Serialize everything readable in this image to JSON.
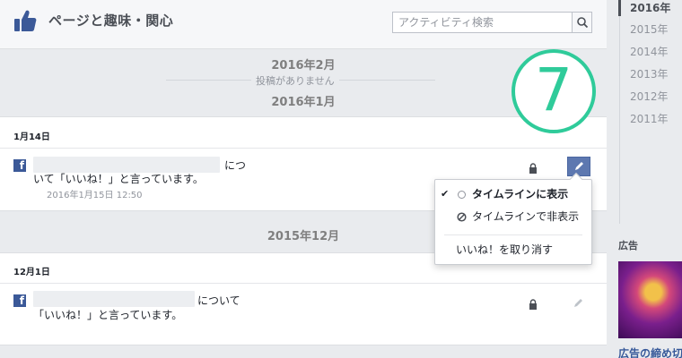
{
  "header": {
    "title": "ページと趣味・関心",
    "search_placeholder": "アクティビティ検索"
  },
  "sections": [
    {
      "month": "2016年2月",
      "no_posts": "投稿がありません"
    },
    {
      "month": "2016年1月"
    },
    {
      "month": "2015年12月"
    }
  ],
  "posts": [
    {
      "date": "1月14日",
      "text_line1": "につ",
      "text_line2": "いて「いいね！」と言っています。",
      "timestamp": "2016年1月15日 12:50"
    },
    {
      "date": "12月1日",
      "text_line1": "について",
      "text_line2": "「いいね！」と言っています。"
    }
  ],
  "dropdown": {
    "items": [
      {
        "label": "タイムラインに表示",
        "checked": true
      },
      {
        "label": "タイムラインで非表示",
        "checked": false
      },
      {
        "label": "いいね！を取り消す"
      }
    ]
  },
  "overlay": {
    "step_number": "7"
  },
  "rail": {
    "years": [
      "2016年",
      "2015年",
      "2014年",
      "2013年",
      "2012年",
      "2011年"
    ],
    "active_year": "2016年",
    "ad_label": "広告",
    "ad_title": "広告の締め切り"
  },
  "colors": {
    "facebook_blue": "#3b5998",
    "accent_green": "#2fcb9a",
    "background": "#e9ebee"
  }
}
